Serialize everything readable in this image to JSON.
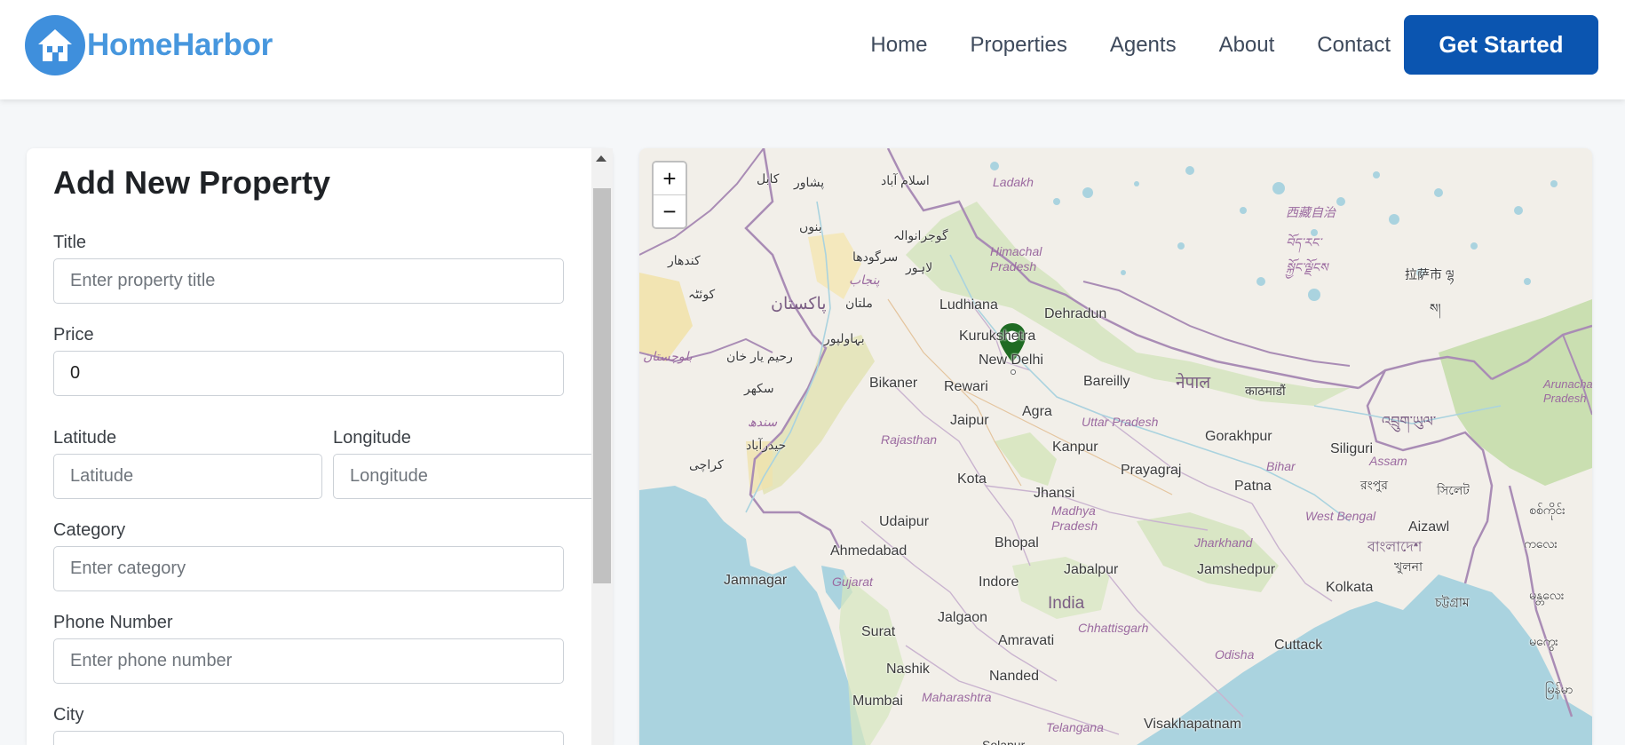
{
  "header": {
    "brand": "HomeHarbor",
    "nav": [
      "Home",
      "Properties",
      "Agents",
      "About",
      "Contact"
    ],
    "cta_label": "Get Started"
  },
  "form": {
    "title": "Add New Property",
    "fields": {
      "title": {
        "label": "Title",
        "placeholder": "Enter property title"
      },
      "price": {
        "label": "Price",
        "value": "0"
      },
      "latitude": {
        "label": "Latitude",
        "placeholder": "Latitude"
      },
      "longitude": {
        "label": "Longitude",
        "placeholder": "Longitude"
      },
      "category": {
        "label": "Category",
        "placeholder": "Enter category"
      },
      "phone": {
        "label": "Phone Number",
        "placeholder": "Enter phone number"
      },
      "city": {
        "label": "City"
      }
    }
  },
  "map": {
    "zoom_in": "+",
    "zoom_out": "−",
    "places": {
      "ladakh": "Ladakh",
      "himachal": "Himachal Pradesh",
      "ludhiana": "Ludhiana",
      "dehradun": "Dehradun",
      "kurukshetra": "Kurukshetra",
      "new_delhi": "New Delhi",
      "bareilly": "Bareilly",
      "bikaner": "Bikaner",
      "rewari": "Rewari",
      "jaipur": "Jaipur",
      "agra": "Agra",
      "uttar_pradesh": "Uttar Pradesh",
      "rajasthan": "Rajasthan",
      "kanpur": "Kanpur",
      "gorakhpur": "Gorakhpur",
      "prayagraj": "Prayagraj",
      "patna": "Patna",
      "bihar": "Bihar",
      "siliguri": "Siliguri",
      "assam": "Assam",
      "kota": "Kota",
      "jhansi": "Jhansi",
      "udaipur": "Udaipur",
      "madhya_pradesh": "Madhya Pradesh",
      "ahmedabad": "Ahmedabad",
      "bhopal": "Bhopal",
      "jharkhand": "Jharkhand",
      "west_bengal": "West Bengal",
      "aizawl": "Aizawl",
      "jamnagar": "Jamnagar",
      "gujarat": "Gujarat",
      "indore": "Indore",
      "jabalpur": "Jabalpur",
      "jamshedpur": "Jamshedpur",
      "kolkata": "Kolkata",
      "india": "India",
      "surat": "Surat",
      "jalgaon": "Jalgaon",
      "chhattisgarh": "Chhattisgarh",
      "amravati": "Amravati",
      "odisha": "Odisha",
      "cuttack": "Cuttack",
      "nashik": "Nashik",
      "nanded": "Nanded",
      "mumbai": "Mumbai",
      "maharashtra": "Maharashtra",
      "telangana": "Telangana",
      "visakhapatnam": "Visakhapatnam",
      "arunachal": "Arunachal Pradesh",
      "kabul": "کابل",
      "peshawar": "پشاور",
      "islamabad": "اسلام آباد",
      "bannu": "بنوں",
      "gujranwala": "گوجرانوالہ",
      "sargodha": "سرگودھا",
      "lahore": "لاہور",
      "punjab": "پنجاب",
      "kandahar": "کندھار",
      "quetta": "کوئٹہ",
      "pakistan": "پاکستان",
      "multan": "ملتان",
      "bahawalpur": "بہاولپور",
      "balochistan": "بلوچستان",
      "rahim_yar_khan": "رحیم یار خان",
      "sukkur": "سکھر",
      "sindh": "سندھ",
      "hyderabad": "حیدرآباد",
      "karachi": "کراچی",
      "nepal": "नेपाल",
      "kathmandu": "काठमाडौं",
      "bhutan": "འབྲུག་ཡུལ་",
      "rangpur": "রংপুর",
      "sylhet": "সিলেট",
      "bangladesh": "বাংলাদেশ",
      "khulna": "খুলনা",
      "chattogram": "চট্টগ্রাম",
      "xizang_cn": "西藏自治",
      "xizang_bo": "བོད་རང་",
      "xizang_bo2": "སྐྱོང་ལྗོངས",
      "lhasa": "拉萨市 ལྷ",
      "lhasa2": "ས།",
      "myanmar1": "စစ်ကိုင်း",
      "myanmar2": "ကလေး",
      "myanmar3": "မန္တလေး",
      "myanmar4": "မကွေး",
      "myanmar5": "မြန်မာ",
      "solapur": "Solapur"
    }
  },
  "colors": {
    "brand": "#4797de",
    "cta": "#0b55b0",
    "water": "#aad3df",
    "land": "#f2efe9",
    "marker": "#1f6b23"
  },
  "icons": {
    "logo": "house-icon",
    "marker": "map-pin-icon"
  }
}
